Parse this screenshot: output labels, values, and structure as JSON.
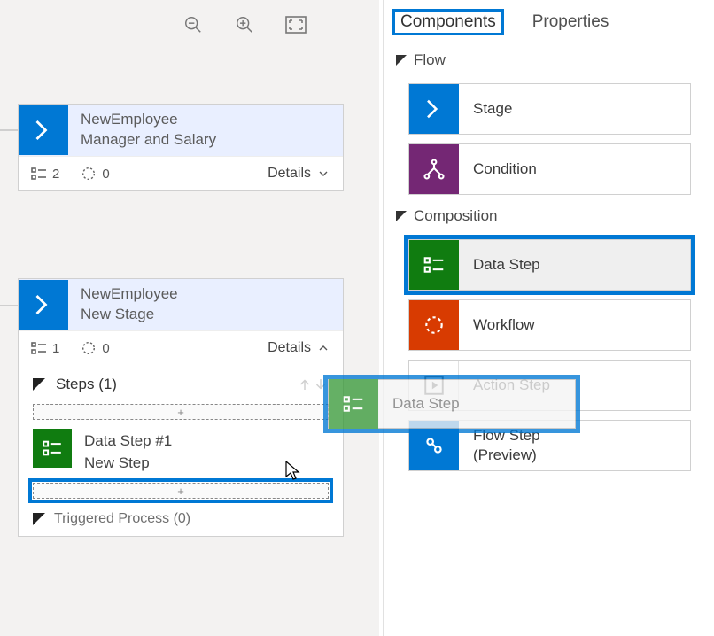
{
  "canvas": {
    "card1": {
      "title": "NewEmployee",
      "subtitle": "Manager and Salary",
      "steps_count": "2",
      "workflow_count": "0",
      "details_label": "Details"
    },
    "card2": {
      "title": "NewEmployee",
      "subtitle": "New Stage",
      "steps_count": "1",
      "workflow_count": "0",
      "details_label": "Details",
      "steps_header": "Steps (1)",
      "dropzone_plus": "+",
      "step1_title": "Data Step #1",
      "step1_subtitle": "New Step",
      "triggered_label": "Triggered Process (0)"
    }
  },
  "panel": {
    "tabs": {
      "components": "Components",
      "properties": "Properties"
    },
    "sections": {
      "flow": "Flow",
      "composition": "Composition"
    },
    "items": {
      "stage": "Stage",
      "condition": "Condition",
      "data_step": "Data Step",
      "workflow": "Workflow",
      "action_step": "Action Step",
      "flow_step": "Flow Step\n(Preview)"
    }
  },
  "drag": {
    "label": "Data Step"
  }
}
